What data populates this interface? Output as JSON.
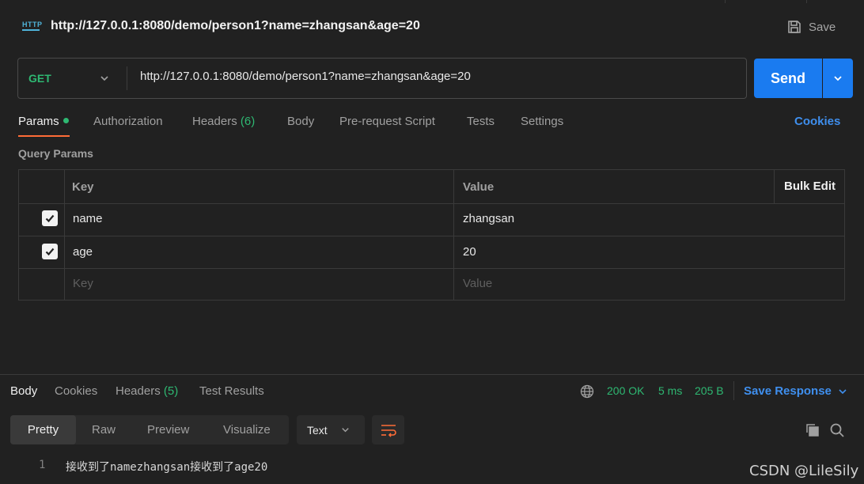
{
  "request": {
    "icon_label": "HTTP",
    "title": "http://127.0.0.1:8080/demo/person1?name=zhangsan&age=20",
    "save_label": "Save",
    "method": "GET",
    "url": "http://127.0.0.1:8080/demo/person1?name=zhangsan&age=20",
    "send_label": "Send"
  },
  "tabs": {
    "params": "Params",
    "authorization": "Authorization",
    "headers": "Headers",
    "headers_count": "(6)",
    "body": "Body",
    "prerequest": "Pre-request Script",
    "tests": "Tests",
    "settings": "Settings",
    "cookies": "Cookies"
  },
  "query_params": {
    "section_title": "Query Params",
    "headers": {
      "key": "Key",
      "value": "Value",
      "bulk_edit": "Bulk Edit"
    },
    "rows": [
      {
        "checked": true,
        "key": "name",
        "value": "zhangsan"
      },
      {
        "checked": true,
        "key": "age",
        "value": "20"
      }
    ],
    "placeholder": {
      "key": "Key",
      "value": "Value"
    }
  },
  "response": {
    "tabs": {
      "body": "Body",
      "cookies": "Cookies",
      "headers": "Headers",
      "headers_count": "(5)",
      "test_results": "Test Results"
    },
    "status": "200 OK",
    "time": "5 ms",
    "size": "205 B",
    "save_response": "Save Response",
    "views": [
      "Pretty",
      "Raw",
      "Preview",
      "Visualize"
    ],
    "format": "Text",
    "lines": [
      {
        "num": "1",
        "text": "接收到了namezhangsan接收到了age20"
      }
    ]
  },
  "watermark": "CSDN @LileSily",
  "colors": {
    "accent_blue": "#1a7bf0",
    "link_blue": "#3f8fee",
    "success_green": "#2eb872",
    "active_tab_orange": "#ff6c37",
    "background": "#212121"
  }
}
